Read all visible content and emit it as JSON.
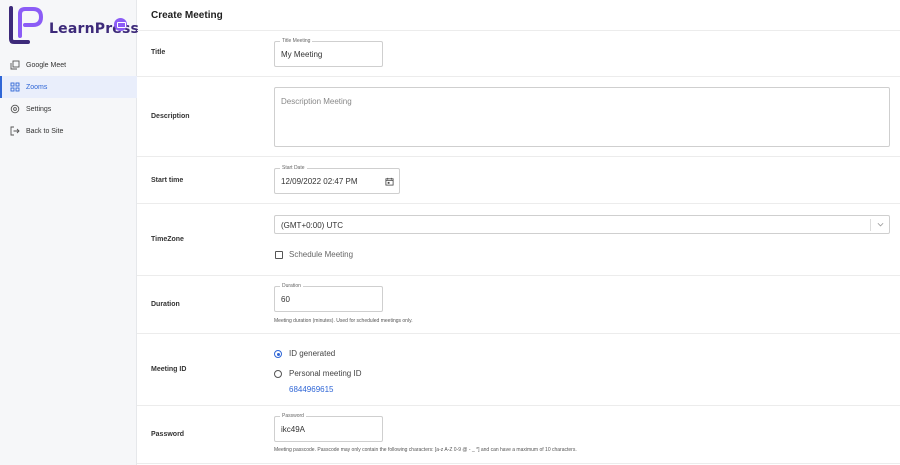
{
  "brand": {
    "name": "LearnPress"
  },
  "sidebar": {
    "items": [
      {
        "label": "Google Meet",
        "icon": "copy-icon"
      },
      {
        "label": "Zooms",
        "icon": "grid-icon",
        "active": true
      },
      {
        "label": "Settings",
        "icon": "gear-icon"
      },
      {
        "label": "Back to Site",
        "icon": "exit-icon"
      }
    ]
  },
  "page": {
    "title": "Create Meeting"
  },
  "form": {
    "title": {
      "label": "Title",
      "legend": "Title Meeting",
      "value": "My Meeting"
    },
    "description": {
      "label": "Description",
      "placeholder": "Description Meeting"
    },
    "start_time": {
      "label": "Start time",
      "legend": "Start Date",
      "value": "12/09/2022 02:47 PM",
      "icon": "calendar-icon"
    },
    "timezone": {
      "label": "TimeZone",
      "value": "(GMT+0:00) UTC",
      "schedule_label": "Schedule Meeting",
      "schedule_checked": false
    },
    "duration": {
      "label": "Duration",
      "legend": "Duration",
      "value": "60",
      "help": "Meeting duration (minutes). Used for scheduled meetings only."
    },
    "meeting_id": {
      "label": "Meeting ID",
      "options": [
        {
          "label": "ID generated",
          "checked": true
        },
        {
          "label": "Personal meeting ID",
          "checked": false
        }
      ],
      "personal_id": "6844969615"
    },
    "password": {
      "label": "Password",
      "legend": "Password",
      "value": "ikc49A",
      "help": "Meeting passcode. Passcode may only contain the following characters: [a-z A-Z 0-9 @ - _ *] and can have a maximum of 10 characters."
    }
  },
  "colors": {
    "accent": "#2f66d6",
    "brand": "#3d2a7a",
    "badge": "#8b5cf6"
  }
}
